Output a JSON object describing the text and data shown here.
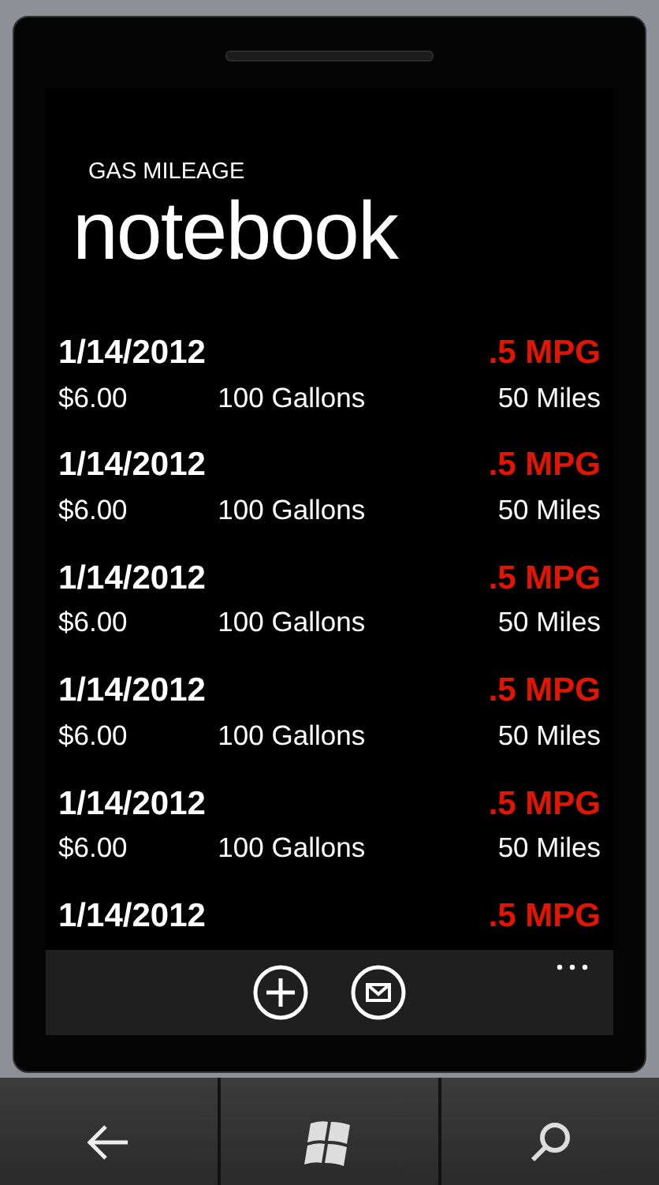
{
  "app_title": "GAS MILEAGE",
  "page_title": "notebook",
  "entries": [
    {
      "date": "1/14/2012",
      "mpg": ".5 MPG",
      "cost": "$6.00",
      "gallons": "100 Gallons",
      "miles": "50 Miles"
    },
    {
      "date": "1/14/2012",
      "mpg": ".5 MPG",
      "cost": "$6.00",
      "gallons": "100 Gallons",
      "miles": "50 Miles"
    },
    {
      "date": "1/14/2012",
      "mpg": ".5 MPG",
      "cost": "$6.00",
      "gallons": "100 Gallons",
      "miles": "50 Miles"
    },
    {
      "date": "1/14/2012",
      "mpg": ".5 MPG",
      "cost": "$6.00",
      "gallons": "100 Gallons",
      "miles": "50 Miles"
    },
    {
      "date": "1/14/2012",
      "mpg": ".5 MPG",
      "cost": "$6.00",
      "gallons": "100 Gallons",
      "miles": "50 Miles"
    },
    {
      "date": "1/14/2012",
      "mpg": ".5 MPG"
    }
  ],
  "app_bar": {
    "buttons": [
      {
        "kind": "add"
      },
      {
        "kind": "mail"
      }
    ]
  },
  "hardware_buttons": [
    {
      "kind": "back"
    },
    {
      "kind": "start"
    },
    {
      "kind": "search"
    }
  ]
}
